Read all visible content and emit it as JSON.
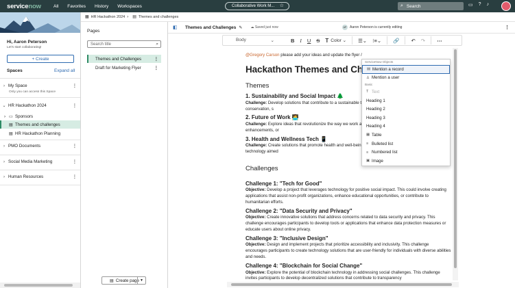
{
  "topbar": {
    "brand_a": "service",
    "brand_b": "now",
    "nav": [
      "All",
      "Favorites",
      "History",
      "Workspaces"
    ],
    "center": "Collaborative Work M...",
    "search_placeholder": "Search"
  },
  "left": {
    "greeting": "Hi, Aaron Peterson",
    "greeting_sub": "Let's start collaborating!",
    "create": "+ Create",
    "spaces": "Spaces",
    "expand_all": "Expand all",
    "my_space": "My Space",
    "my_space_sub": "Only you can access this Space",
    "hr": "HR Hackathon 2024",
    "tree": [
      "Sponsors",
      "Themes and challenges",
      "HR Hackathon Planning"
    ],
    "others": [
      "PMO Documents",
      "Social Media Marketing",
      "Human Resources"
    ]
  },
  "crumb": {
    "a": "HR Hackathon 2024",
    "b": "Themes and challenges"
  },
  "pages": {
    "heading": "Pages",
    "search_placeholder": "Search title",
    "items": [
      "Themes and Challenges",
      "Draft for Marketing Flyer"
    ],
    "create": "Create page"
  },
  "editor": {
    "title": "Themes and Challenges",
    "saved": "Saved just now",
    "editing": "Aaron Peterson is currently editing",
    "avatar_initials": "AP",
    "style": "Body",
    "color": "Color",
    "mention": "@Gregory Carson",
    "mention_rest": " please add your ideas and update the flyer /",
    "h1": "Hackathon Themes and Challe",
    "themes_h": "Themes",
    "themes": [
      {
        "title": "1. Sustainability and Social Impact 🌲",
        "lbl": "Challenge:",
        "text": "Develop solutions that contribute to a sustainable t could include projects related to environmental conservation, s"
      },
      {
        "title": "2. Future of Work 🧑‍💻",
        "lbl": "Challenge:",
        "text": "Explore ideas that revolutionize the way we work a encompass remote work tools, productivity enhancements, or"
      },
      {
        "title": "3. Health and Wellness Tech 📱",
        "lbl": "Challenge:",
        "text": "Create solutions that promote health and well-bein applications, mental health support tools, or technology aimed"
      }
    ],
    "challenges_h": "Challenges",
    "challenges": [
      {
        "title": "Challenge 1: \"Tech for Good\"",
        "lbl": "Objective:",
        "text": "Develop a project that leverages technology for positive social impact. This could involve creating applications that assist non-profit organizations, enhance educational opportunities, or contribute to humanitarian efforts."
      },
      {
        "title": "Challenge 2: \"Data Security and Privacy\"",
        "lbl": "Objective:",
        "text": "Create innovative solutions that address concerns related to data security and privacy. This challenge encourages participants to develop tools or applications that enhance data protection measures or educate users about online privacy."
      },
      {
        "title": "Challenge 3: \"Inclusive Design\"",
        "lbl": "Objective:",
        "text": "Design and implement projects that prioritize accessibility and inclusivity. This challenge encourages participants to create technology solutions that are user-friendly for individuals with diverse abilities and needs."
      },
      {
        "title": "Challenge 4: \"Blockchain for Social Change\"",
        "lbl": "Objective:",
        "text": "Explore the potential of blockchain technology in addressing social challenges. This challenge invites participants to develop decentralized solutions that contribute to transparency"
      }
    ]
  },
  "popup": {
    "sec1": "ServiceNow Objects",
    "sec2": "Basic",
    "items1": [
      "Mention a record",
      "Mention a user"
    ],
    "items2": [
      "Text",
      "Heading 1",
      "Heading 2",
      "Heading 3",
      "Heading 4",
      "Table",
      "Bulleted list",
      "Numbered list",
      "Image"
    ]
  },
  "colors": {
    "topbar": "#293e40",
    "accent": "#2d6ab0",
    "selected": "#d6ece3",
    "mention": "#c8642b"
  }
}
